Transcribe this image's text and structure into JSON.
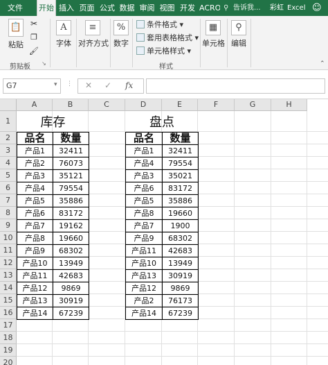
{
  "ribbon_tabs": [
    "文件",
    "开始",
    "插入",
    "页面",
    "公式",
    "数据",
    "审阅",
    "视图",
    "开发",
    "ACRO"
  ],
  "tell_me": "告诉我...",
  "user_name": "彩虹",
  "app_name": "Excel",
  "clipboard": {
    "paste_label": "粘贴",
    "group_label": "剪贴板"
  },
  "font_group_label": "字体",
  "align_group_label": "对齐方式",
  "number_group_label": "数字",
  "styles": {
    "conditional": "条件格式",
    "table_format": "套用表格格式",
    "cell_styles": "单元格样式",
    "group_label": "样式"
  },
  "cells_label": "单元格",
  "edit_label": "编辑",
  "name_box": "G7",
  "formula_fx": "fx",
  "columns": [
    "A",
    "B",
    "C",
    "D",
    "E",
    "F",
    "G",
    "H"
  ],
  "rows": [
    "1",
    "2",
    "3",
    "4",
    "5",
    "6",
    "7",
    "8",
    "9",
    "10",
    "11",
    "12",
    "13",
    "14",
    "15",
    "16",
    "17",
    "18",
    "19",
    "20"
  ],
  "inventory": {
    "title": "库存",
    "header": [
      "品名",
      "数量"
    ],
    "rows": [
      [
        "产品1",
        "32411"
      ],
      [
        "产品2",
        "76073"
      ],
      [
        "产品3",
        "35121"
      ],
      [
        "产品4",
        "79554"
      ],
      [
        "产品5",
        "35886"
      ],
      [
        "产品6",
        "83172"
      ],
      [
        "产品7",
        "19162"
      ],
      [
        "产品8",
        "19660"
      ],
      [
        "产品9",
        "68302"
      ],
      [
        "产品10",
        "13949"
      ],
      [
        "产品11",
        "42683"
      ],
      [
        "产品12",
        "9869"
      ],
      [
        "产品13",
        "30919"
      ],
      [
        "产品14",
        "67239"
      ]
    ]
  },
  "stocktake": {
    "title": "盘点",
    "header": [
      "品名",
      "数量"
    ],
    "rows": [
      [
        "产品1",
        "32411"
      ],
      [
        "产品4",
        "79554"
      ],
      [
        "产品3",
        "35021"
      ],
      [
        "产品6",
        "83172"
      ],
      [
        "产品5",
        "35886"
      ],
      [
        "产品8",
        "19660"
      ],
      [
        "产品7",
        "1900"
      ],
      [
        "产品9",
        "68302"
      ],
      [
        "产品11",
        "42683"
      ],
      [
        "产品10",
        "13949"
      ],
      [
        "产品13",
        "30919"
      ],
      [
        "产品12",
        "9869"
      ],
      [
        "产品2",
        "76173"
      ],
      [
        "产品14",
        "67239"
      ]
    ]
  }
}
